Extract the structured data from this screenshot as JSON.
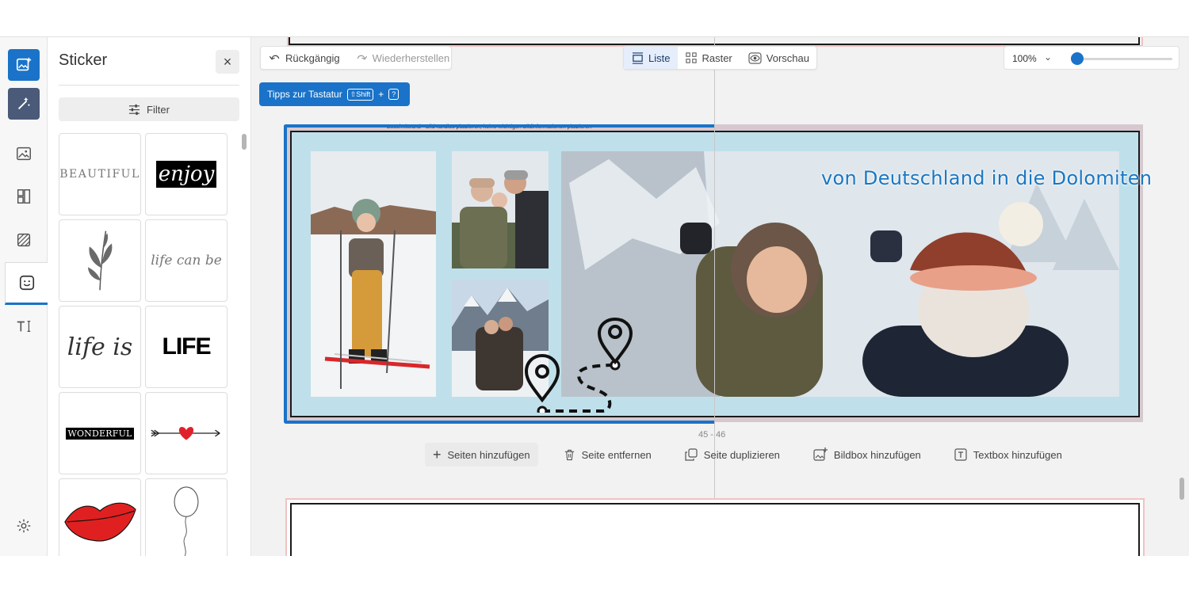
{
  "panel": {
    "title": "Sticker",
    "close_label": "×",
    "filter_label": "Filter"
  },
  "stickers": {
    "beautiful": "BEAUTIFUL",
    "enjoy": "enjoy",
    "life_can_be": "life can be",
    "life_is": "life is",
    "life": "LIFE",
    "wonderful": "WONDERFUL"
  },
  "toolbar": {
    "undo_label": "Rückgängig",
    "redo_label": "Wiederherstellen",
    "list_label": "Liste",
    "grid_label": "Raster",
    "preview_label": "Vorschau",
    "zoom_value": "100%",
    "zoom_slider_fraction": 0.0
  },
  "tips": {
    "label": "Tipps zur Tastatur",
    "key_shift": "⇧Shift",
    "plus": "+",
    "key_question": "?"
  },
  "spread": {
    "bleed_note": "Beschnittrand - Bild randlos platzieren, keine wichtigen Bildinformationen platzieren",
    "headline": "von Deutschland in die Dolomiten",
    "page_numbers": "45 - 46"
  },
  "actions": {
    "add_pages": "Seiten hinzufügen",
    "remove_page": "Seite entfernen",
    "duplicate_page": "Seite duplizieren",
    "add_imagebox": "Bildbox hinzufügen",
    "add_textbox": "Textbox hinzufügen"
  },
  "colors": {
    "accent": "#1a73c8",
    "page_background": "#bfe0ea",
    "headline": "#1a77c2"
  }
}
